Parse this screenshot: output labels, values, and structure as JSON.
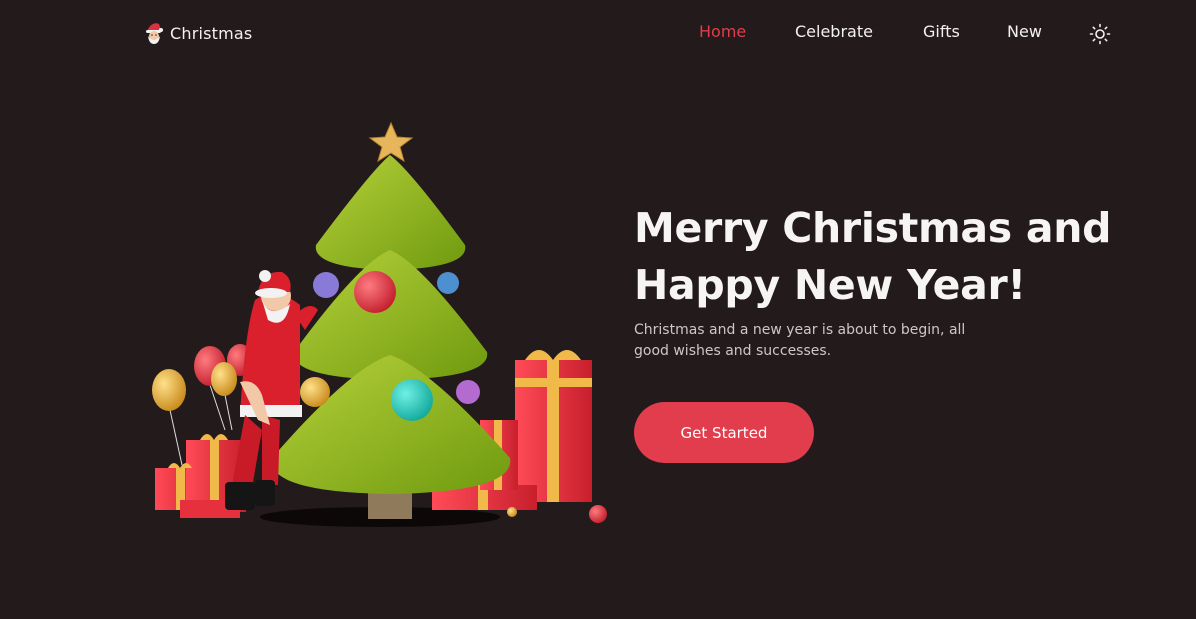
{
  "header": {
    "logo_text": "Christmas",
    "logo_icon": "santa-icon",
    "nav": [
      {
        "label": "Home",
        "active": true
      },
      {
        "label": "Celebrate",
        "active": false
      },
      {
        "label": "Gifts",
        "active": false
      },
      {
        "label": "New",
        "active": false
      }
    ],
    "theme_icon": "sun-icon"
  },
  "hero": {
    "title_line1": "Merry Christmas and",
    "title_line2": "Happy New Year!",
    "description": "Christmas and a new year is about to begin, all good wishes and successes.",
    "cta_label": "Get Started"
  },
  "colors": {
    "background": "#231a1b",
    "accent": "#e23d4d",
    "text": "#f4f1f1"
  }
}
